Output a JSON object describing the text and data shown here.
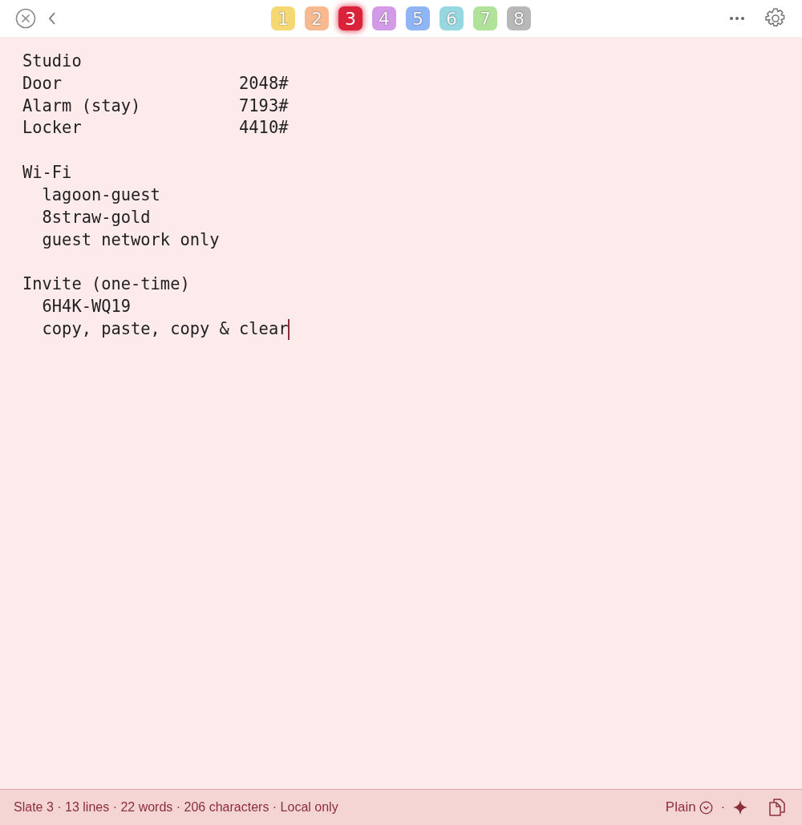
{
  "tabs": [
    {
      "label": "1",
      "color": "#f6d873",
      "selected": false
    },
    {
      "label": "2",
      "color": "#f9b98f",
      "selected": false
    },
    {
      "label": "3",
      "color": "#d9233a",
      "selected": true
    },
    {
      "label": "4",
      "color": "#d39ae8",
      "selected": false
    },
    {
      "label": "5",
      "color": "#8fb5f5",
      "selected": false
    },
    {
      "label": "6",
      "color": "#97d8e0",
      "selected": false
    },
    {
      "label": "7",
      "color": "#b1e29a",
      "selected": false
    },
    {
      "label": "8",
      "color": "#b8b8b8",
      "selected": false
    }
  ],
  "editor": {
    "blocks": [
      {
        "lines": [
          {
            "text": "Studio"
          },
          {
            "text": "Door",
            "value": "2048#"
          },
          {
            "text": "Alarm (stay)",
            "value": "7193#"
          },
          {
            "text": "Locker",
            "value": "4410#"
          }
        ]
      },
      {
        "lines": [
          {
            "text": "Wi-Fi",
            "children": [
              {
                "text": "lagoon-guest"
              },
              {
                "text": "8straw-gold"
              },
              {
                "text": "guest network only"
              }
            ]
          }
        ]
      },
      {
        "lines": [
          {
            "text": "Invite (one-time)",
            "children": [
              {
                "text": "6H4K-WQ19"
              },
              {
                "text": "copy, paste, copy & clear",
                "cursor": true
              }
            ]
          }
        ]
      }
    ]
  },
  "status_bar": {
    "info": "Slate 3 · 13 lines · 22 words · 206 characters · Local only",
    "format": "Plain",
    "separator": "·"
  }
}
